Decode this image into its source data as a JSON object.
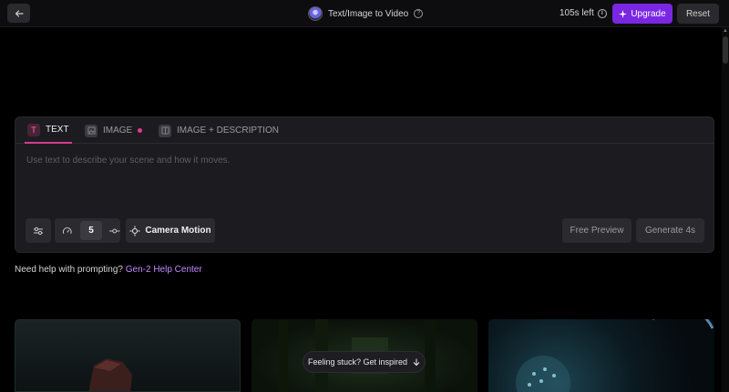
{
  "header": {
    "title": "Text/Image to Video",
    "time_left": "105s left",
    "upgrade_label": "Upgrade",
    "reset_label": "Reset"
  },
  "tabs": [
    {
      "label": "TEXT",
      "icon": "text-icon",
      "active": true
    },
    {
      "label": "IMAGE",
      "icon": "image-icon",
      "active": false,
      "has_dot": true
    },
    {
      "label": "IMAGE + DESCRIPTION",
      "icon": "image-description-icon",
      "active": false
    }
  ],
  "prompt": {
    "placeholder": "Use text to describe your scene and how it moves."
  },
  "controls": {
    "speed_value": "5",
    "camera_motion_label": "Camera Motion",
    "free_preview_label": "Free Preview",
    "generate_label": "Generate 4s"
  },
  "help": {
    "text": "Need help with prompting?",
    "link": "Gen-2 Help Center"
  },
  "inspire": {
    "label": "Feeling stuck? Get inspired"
  },
  "colors": {
    "accent_upgrade": "#7a27e3",
    "tab_active_underline": "#d43c8f",
    "link": "#c58bff",
    "background": "#000000",
    "panel": "#1c1c20"
  }
}
